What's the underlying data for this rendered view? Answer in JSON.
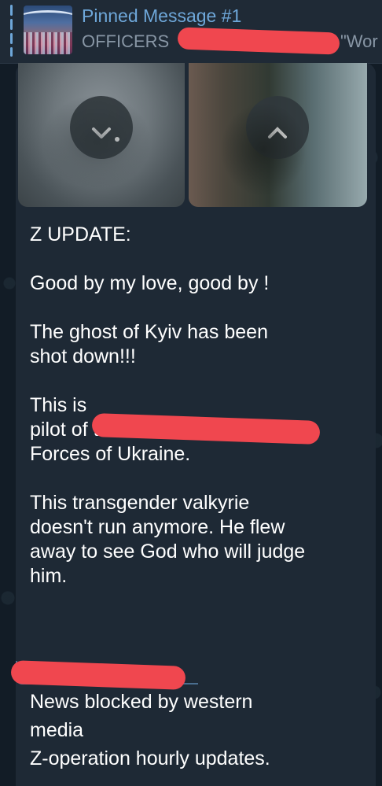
{
  "pinned": {
    "title": "Pinned Message #1",
    "channel": "OFFICERS",
    "preview_tail": "\"Wor"
  },
  "message": {
    "body": "Z UPDATE:\n\nGood by my love, good by !\n\nThe ghost of Kyiv has been\nshot down!!!\n\nThis is\npilot of the Su-25 of the Armed\nForces of Ukraine.\n\nThis transgender valkyrie\ndoesn't run anymore. He flew\naway to see God who will judge\nhim.",
    "signature": "News blocked by western\nmedia\nZ-operation hourly updates."
  },
  "icons": {
    "pin_thumbnail": "stadium-photo-thumbnail",
    "close_left": "close-icon",
    "close_right": "close-icon"
  },
  "colors": {
    "accent": "#6ea7d9",
    "bubble": "#1e2935",
    "redaction": "#f0474f"
  }
}
